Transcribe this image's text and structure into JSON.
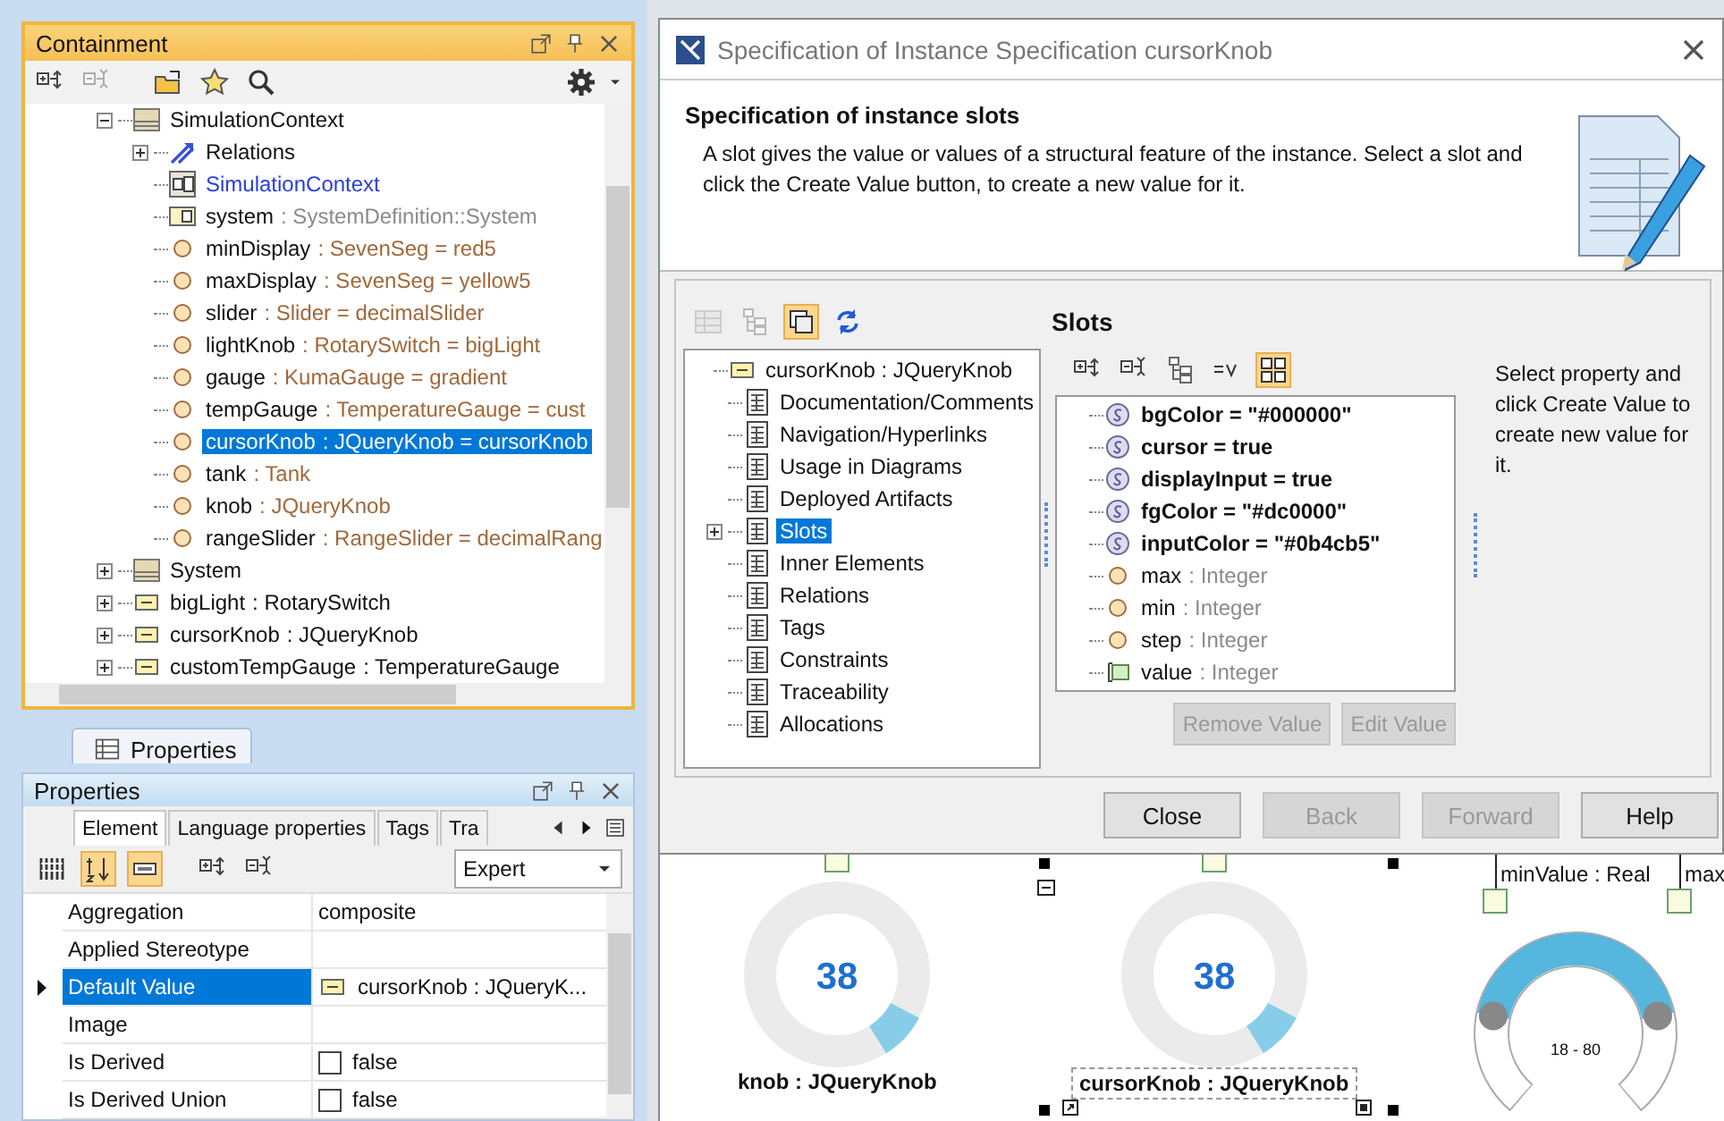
{
  "containment": {
    "title": "Containment",
    "toolbar": [
      {
        "kind": "expand",
        "disabled": false
      },
      {
        "kind": "collapse",
        "disabled": true
      },
      {
        "kind": "folder",
        "disabled": false
      },
      {
        "kind": "star",
        "disabled": false
      },
      {
        "kind": "search",
        "disabled": false
      }
    ],
    "tree": [
      {
        "kind": "package",
        "name": "SimulationContext",
        "expanded": true,
        "selected": false,
        "children": [
          {
            "kind": "relations",
            "name": "Relations",
            "expanded": false,
            "selected": false
          },
          {
            "kind": "diagram",
            "name": "SimulationContext",
            "selected": false
          },
          {
            "kind": "part",
            "name": "system",
            "detail": ": SystemDefinition::System",
            "selected": false
          },
          {
            "kind": "property",
            "name": "minDisplay",
            "detail": ": SevenSeg = red5",
            "selected": false
          },
          {
            "kind": "property",
            "name": "maxDisplay",
            "detail": ": SevenSeg = yellow5",
            "selected": false
          },
          {
            "kind": "property",
            "name": "slider",
            "detail": ": Slider = decimalSlider",
            "selected": false
          },
          {
            "kind": "property",
            "name": "lightKnob",
            "detail": ": RotarySwitch = bigLight",
            "selected": false
          },
          {
            "kind": "property",
            "name": "gauge",
            "detail": ": KumaGauge = gradient",
            "selected": false
          },
          {
            "kind": "property",
            "name": "tempGauge",
            "detail": ": TemperatureGauge = cust",
            "selected": false
          },
          {
            "kind": "property",
            "name": "cursorKnob",
            "detail": ": JQueryKnob = cursorKnob",
            "selected": true
          },
          {
            "kind": "property",
            "name": "tank",
            "detail": ": Tank",
            "selected": false
          },
          {
            "kind": "property",
            "name": "knob",
            "detail": ": JQueryKnob",
            "selected": false
          },
          {
            "kind": "property",
            "name": "rangeSlider",
            "detail": ": RangeSlider = decimalRang",
            "selected": false
          }
        ]
      },
      {
        "kind": "package",
        "name": "System",
        "expanded": false,
        "selected": false
      },
      {
        "kind": "instance",
        "name": "bigLight",
        "detail": ": RotarySwitch",
        "expanded": false,
        "selected": false
      },
      {
        "kind": "instance",
        "name": "cursorKnob",
        "detail": ": JQueryKnob",
        "expanded": false,
        "selected": false
      },
      {
        "kind": "instance",
        "name": "customTempGauge",
        "detail": ": TemperatureGauge",
        "expanded": false,
        "selected": false
      }
    ]
  },
  "properties_tab": {
    "label": "Properties"
  },
  "properties": {
    "title": "Properties",
    "tabs": [
      {
        "label": "Element",
        "selected": true
      },
      {
        "label": "Language properties",
        "selected": false
      },
      {
        "label": "Tags",
        "selected": false
      },
      {
        "label": "Tra",
        "selected": false
      }
    ],
    "toolbar": [
      {
        "kind": "columns",
        "selected": false
      },
      {
        "kind": "sort",
        "selected": true
      },
      {
        "kind": "field",
        "selected": true
      },
      {
        "kind": "expand",
        "selected": false
      },
      {
        "kind": "collapse",
        "selected": false
      }
    ],
    "mode": {
      "value": "Expert"
    },
    "rows": [
      {
        "kind": "text",
        "name": "Aggregation",
        "value": "composite",
        "selected": false
      },
      {
        "kind": "text",
        "name": "Applied Stereotype",
        "selected": false
      },
      {
        "kind": "reference",
        "name": "Default Value",
        "value": "cursorKnob : JQueryK...",
        "selected": true
      },
      {
        "kind": "text",
        "name": "Image",
        "selected": false
      },
      {
        "kind": "checkbox",
        "name": "Is Derived",
        "value": "false",
        "checked": false,
        "selected": false
      },
      {
        "kind": "checkbox",
        "name": "Is Derived Union",
        "value": "false",
        "checked": false,
        "selected": false
      }
    ]
  },
  "dialog": {
    "title": "Specification of Instance Specification cursorKnob",
    "heading": "Specification of instance slots",
    "description": "A slot gives the value or values of a structural feature of the instance. Select a slot and click the Create Value button, to create a new value for it.",
    "nav_toolbar": [
      {
        "kind": "table",
        "selected": false,
        "disabled": true
      },
      {
        "kind": "hierarchy",
        "selected": false,
        "disabled": true
      },
      {
        "kind": "copy",
        "selected": true,
        "disabled": false
      },
      {
        "kind": "refresh",
        "selected": false,
        "disabled": false
      }
    ],
    "nav_tree": [
      {
        "kind": "instance",
        "name": "cursorKnob : JQueryKnob",
        "selected": false,
        "children": [
          {
            "name": "Documentation/Comments",
            "selected": false
          },
          {
            "name": "Navigation/Hyperlinks",
            "selected": false
          },
          {
            "name": "Usage in Diagrams",
            "selected": false
          },
          {
            "name": "Deployed Artifacts",
            "selected": false
          },
          {
            "name": "Slots",
            "selected": true,
            "expanded": false
          },
          {
            "name": "Inner Elements",
            "selected": false
          },
          {
            "name": "Relations",
            "selected": false
          },
          {
            "name": "Tags",
            "selected": false
          },
          {
            "name": "Constraints",
            "selected": false
          },
          {
            "name": "Traceability",
            "selected": false
          },
          {
            "name": "Allocations",
            "selected": false
          }
        ]
      }
    ],
    "slots_title": "Slots",
    "slot_toolbar": [
      {
        "kind": "expand",
        "selected": false
      },
      {
        "kind": "collapse",
        "selected": false
      },
      {
        "kind": "hierarchy",
        "selected": false
      },
      {
        "kind": "equals",
        "selected": false
      },
      {
        "kind": "grid",
        "selected": true
      }
    ],
    "slots": [
      {
        "kind": "slot",
        "name": "bgColor = \"#000000\""
      },
      {
        "kind": "slot",
        "name": "cursor = true"
      },
      {
        "kind": "slot",
        "name": "displayInput = true"
      },
      {
        "kind": "slot",
        "name": "fgColor = \"#dc0000\""
      },
      {
        "kind": "slot",
        "name": "inputColor = \"#0b4cb5\""
      },
      {
        "kind": "property",
        "name": "max",
        "detail": ": Integer"
      },
      {
        "kind": "property",
        "name": "min",
        "detail": ": Integer"
      },
      {
        "kind": "property",
        "name": "step",
        "detail": ": Integer"
      },
      {
        "kind": "port",
        "name": "value",
        "detail": ": Integer"
      }
    ],
    "hint": "Select property and click Create Value to create new value for it.",
    "slot_buttons": [
      {
        "label": "Remove Value",
        "disabled": true
      },
      {
        "label": "Edit Value",
        "disabled": true
      }
    ],
    "buttons": [
      {
        "label": "Close",
        "disabled": false
      },
      {
        "label": "Back",
        "disabled": true
      },
      {
        "label": "Forward",
        "disabled": true
      },
      {
        "label": "Help",
        "disabled": false
      }
    ]
  },
  "diagram": {
    "knobs": [
      {
        "value": "38",
        "label": "knob : JQueryKnob",
        "selected": false
      },
      {
        "value": "38",
        "label": "cursorKnob : JQueryKnob",
        "selected": true
      }
    ],
    "range_slider": {
      "ports": [
        "minValue : Real",
        "max"
      ],
      "reading": "18 - 80"
    }
  }
}
